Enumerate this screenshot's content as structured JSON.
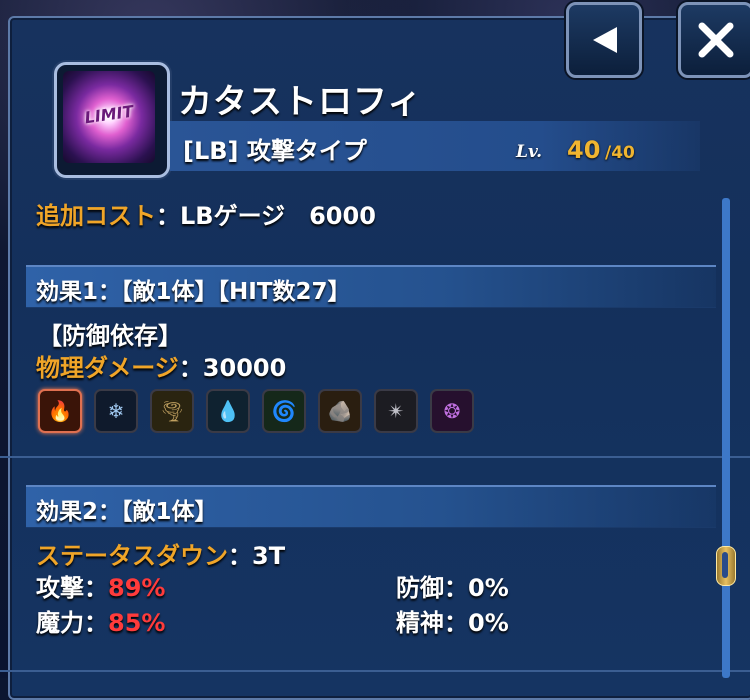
{
  "header": {
    "skill_name": "カタストロフィ",
    "skill_type": "[LB] 攻撃タイプ",
    "icon_label": "LIMIT",
    "level_label": "Lv.",
    "level_current": "40",
    "level_max": "/40"
  },
  "cost": {
    "label": "追加コスト",
    "value": "：LBゲージ　6000"
  },
  "effect1": {
    "title": "効果1：【敵1体】【HIT数27】",
    "dependency": "【防御依存】",
    "damage_label": "物理ダメージ",
    "damage_value": "：30000",
    "elements": [
      {
        "name": "fire",
        "glyph": "🔥",
        "active": true
      },
      {
        "name": "ice",
        "glyph": "❄",
        "active": false
      },
      {
        "name": "wind",
        "glyph": "🌪",
        "active": false
      },
      {
        "name": "water",
        "glyph": "💧",
        "active": false
      },
      {
        "name": "lightning",
        "glyph": "🌀",
        "active": false
      },
      {
        "name": "earth",
        "glyph": "🪨",
        "active": false
      },
      {
        "name": "light",
        "glyph": "✴",
        "active": false
      },
      {
        "name": "dark",
        "glyph": "❂",
        "active": false
      }
    ]
  },
  "effect2": {
    "title": "効果2：【敵1体】",
    "status_label": "ステータスダウン",
    "status_value": "：3T",
    "stats": [
      {
        "label": "攻撃：",
        "value": "89%",
        "highlight": true
      },
      {
        "label": "防御：",
        "value": "0%",
        "highlight": false
      },
      {
        "label": "魔力：",
        "value": "85%",
        "highlight": true
      },
      {
        "label": "精神：",
        "value": "0%",
        "highlight": false
      }
    ]
  },
  "colors": {
    "accent_orange": "#f0a528",
    "highlight_red": "#ff3b3b",
    "panel_blue": "#17325e"
  }
}
